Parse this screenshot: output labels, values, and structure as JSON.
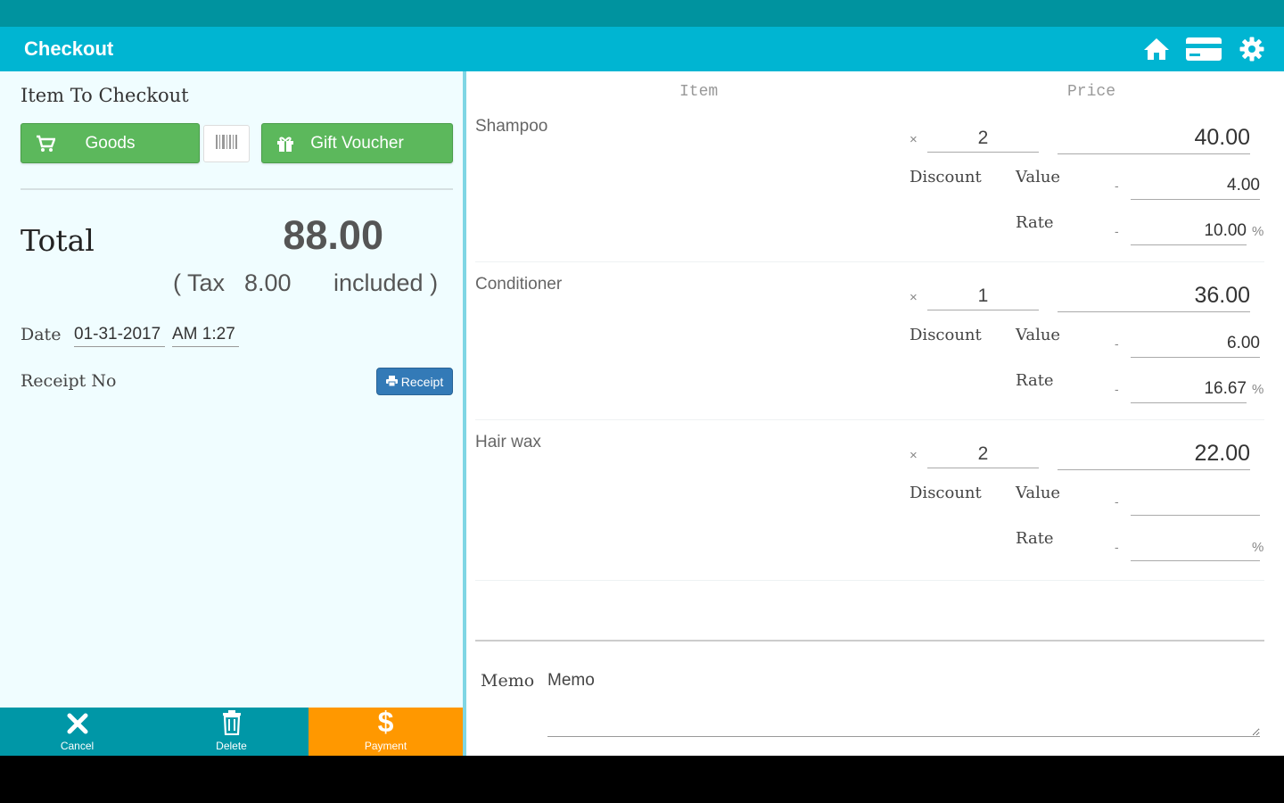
{
  "appbar": {
    "title": "Checkout",
    "icons": [
      "home-icon",
      "card-icon",
      "gear-icon"
    ]
  },
  "left": {
    "heading": "Item To Checkout",
    "goods_label": "Goods",
    "gift_voucher_label": "Gift Voucher",
    "total_label": "Total",
    "total_value": "88.00",
    "tax_open": "( Tax",
    "tax_value": "8.00",
    "tax_close": "included )",
    "date_label": "Date",
    "date_value": "01-31-2017",
    "time_value": "AM 1:27",
    "receipt_no_label": "Receipt No",
    "receipt_button": "Receipt"
  },
  "bottom": {
    "cancel": "Cancel",
    "delete": "Delete",
    "payment": "Payment"
  },
  "columns": {
    "item": "Item",
    "price": "Price"
  },
  "labels": {
    "times": "×",
    "discount": "Discount",
    "value": "Value",
    "rate": "Rate",
    "dash": "-",
    "percent": "%"
  },
  "items": [
    {
      "name": "Shampoo",
      "qty": "2",
      "price": "40.00",
      "disc_value": "4.00",
      "disc_rate": "10.00"
    },
    {
      "name": "Conditioner",
      "qty": "1",
      "price": "36.00",
      "disc_value": "6.00",
      "disc_rate": "16.67"
    },
    {
      "name": "Hair wax",
      "qty": "2",
      "price": "22.00",
      "disc_value": "",
      "disc_rate": ""
    }
  ],
  "memo": {
    "label": "Memo",
    "placeholder": "Memo"
  },
  "colors": {
    "statusbar": "#00939f",
    "appbar": "#00b5d2",
    "goods_button": "#5cb85c",
    "receipt_button": "#337ab7",
    "bottom_bar": "#0097a7",
    "payment": "#ff9800"
  }
}
